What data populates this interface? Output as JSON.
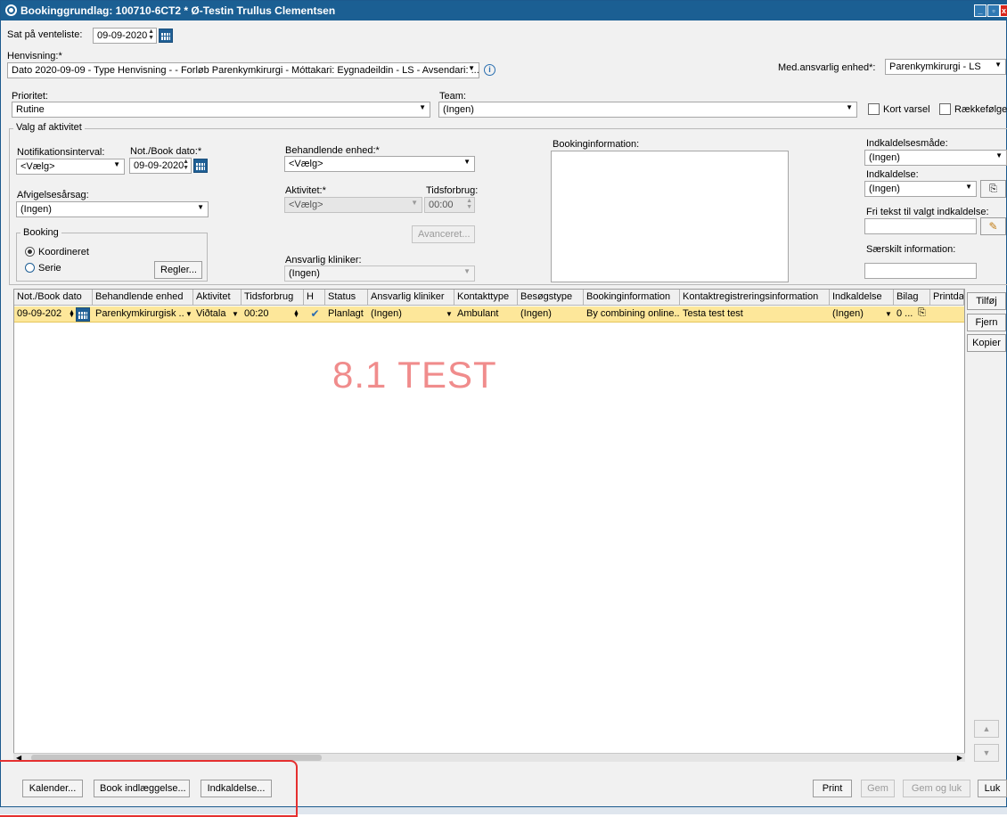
{
  "window": {
    "title": "Bookinggrundlag: 100710-6CT2 * Ø-Testin Trullus Clementsen",
    "minimize": "_",
    "restore": "▫",
    "close": "x"
  },
  "top": {
    "waitlist_label": "Sat på venteliste:",
    "waitlist_date": "09-09-2020",
    "referral_label": "Henvisning:*",
    "referral_value": "Dato 2020-09-09 - Type Henvisning -  - Forløb Parenkymkirurgi - Móttakari: Eygnadeildin - LS  - Avsendari: ...",
    "responsible_unit_label": "Med.ansvarlig enhed*:",
    "responsible_unit_value": "Parenkymkirurgi - LS",
    "priority_label": "Prioritet:",
    "priority_value": "Rutine",
    "team_label": "Team:",
    "team_value": "(Ingen)",
    "short_notice_label": "Kort varsel",
    "order_label": "Rækkefølge"
  },
  "activity": {
    "group_label": "Valg af aktivitet",
    "notif_interval_label": "Notifikationsinterval:",
    "notif_interval_value": "<Vælg>",
    "notbook_date_label": "Not./Book dato:*",
    "notbook_date_value": "09-09-2020",
    "cancel_reason_label": "Afvigelsesårsag:",
    "cancel_reason_value": "(Ingen)",
    "booking_group_label": "Booking",
    "coordinated_label": "Koordineret",
    "series_label": "Serie",
    "rules_button": "Regler...",
    "treating_unit_label": "Behandlende enhed:*",
    "treating_unit_value": "<Vælg>",
    "activity_label": "Aktivitet:*",
    "activity_value": "<Vælg>",
    "time_usage_label": "Tidsforbrug:",
    "time_usage_value": "00:00",
    "advanced_button": "Avanceret...",
    "responsible_clinician_label": "Ansvarlig kliniker:",
    "responsible_clinician_value": "(Ingen)",
    "booking_info_label": "Bookinginformation:",
    "call_method_label": "Indkaldelsesmåde:",
    "call_method_value": "(Ingen)",
    "call_label": "Indkaldelse:",
    "call_value": "(Ingen)",
    "free_text_label": "Fri tekst til valgt indkaldelse:",
    "special_info_label": "Særskilt information:"
  },
  "table": {
    "headers": [
      "Not./Book dato",
      "Behandlende enhed",
      "Aktivitet",
      "Tidsforbrug",
      "H",
      "Status",
      "Ansvarlig kliniker",
      "Kontakttype",
      "Besøgstype",
      "Bookinginformation",
      "Kontaktregistreringsinformation",
      "Indkaldelse",
      "Bilag",
      "Printda"
    ],
    "row": {
      "date": "09-09-202",
      "unit": "Parenkymkirurgisk ...",
      "activity": "Viðtala",
      "time": "00:20",
      "status": "Planlagt",
      "clinician": "(Ingen)",
      "contact_type": "Ambulant",
      "visit_type": "(Ingen)",
      "booking_info": "By combining online...",
      "contact_reg_info": "Testa test test",
      "call": "(Ingen)",
      "attachment": "0 ..."
    }
  },
  "side_buttons": {
    "add": "Tilføj",
    "remove": "Fjern",
    "copy": "Kopier"
  },
  "watermark": "8.1 TEST",
  "bottom_buttons": {
    "calendar": "Kalender...",
    "book_admission": "Book indlæggelse...",
    "call": "Indkaldelse...",
    "print": "Print",
    "save": "Gem",
    "save_close": "Gem og luk",
    "close": "Luk"
  },
  "colors": {
    "titlebar": "#1b5f93",
    "selected_row": "#fde79a",
    "watermark": "#f08c8c",
    "annotation": "#e53030"
  }
}
